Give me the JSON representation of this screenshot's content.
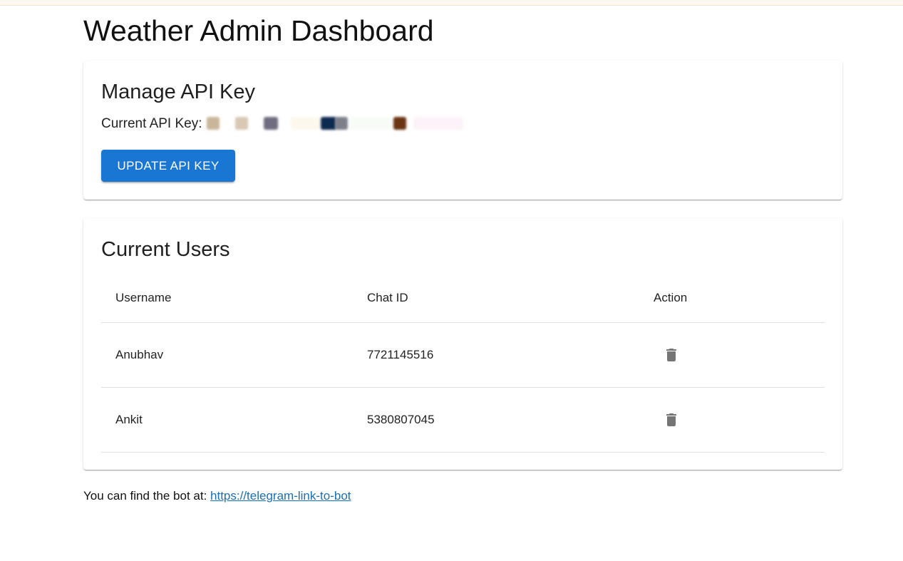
{
  "page": {
    "title": "Weather Admin Dashboard"
  },
  "api_card": {
    "title": "Manage API Key",
    "current_key_label": "Current API Key:",
    "update_button_label": "UPDATE API KEY",
    "redaction_colors": [
      "#c9b59a",
      "#d8c8b4",
      "#6f6d80",
      "#fbf6e6",
      "#0d2a4f",
      "#7d808a",
      "#f4fbf4",
      "#6a3515",
      "#fbeef8"
    ]
  },
  "users_card": {
    "title": "Current Users",
    "columns": [
      "Username",
      "Chat ID",
      "Action"
    ],
    "rows": [
      {
        "username": "Anubhav",
        "chat_id": "7721145516",
        "action_icon": "delete-icon"
      },
      {
        "username": "Ankit",
        "chat_id": "5380807045",
        "action_icon": "delete-icon"
      }
    ]
  },
  "footer": {
    "text": "You can find the bot at:",
    "link_text": "https://telegram-link-to-bot"
  },
  "colors": {
    "primary": "#1976d2",
    "link": "#1a6fb5",
    "icon": "#757575"
  }
}
